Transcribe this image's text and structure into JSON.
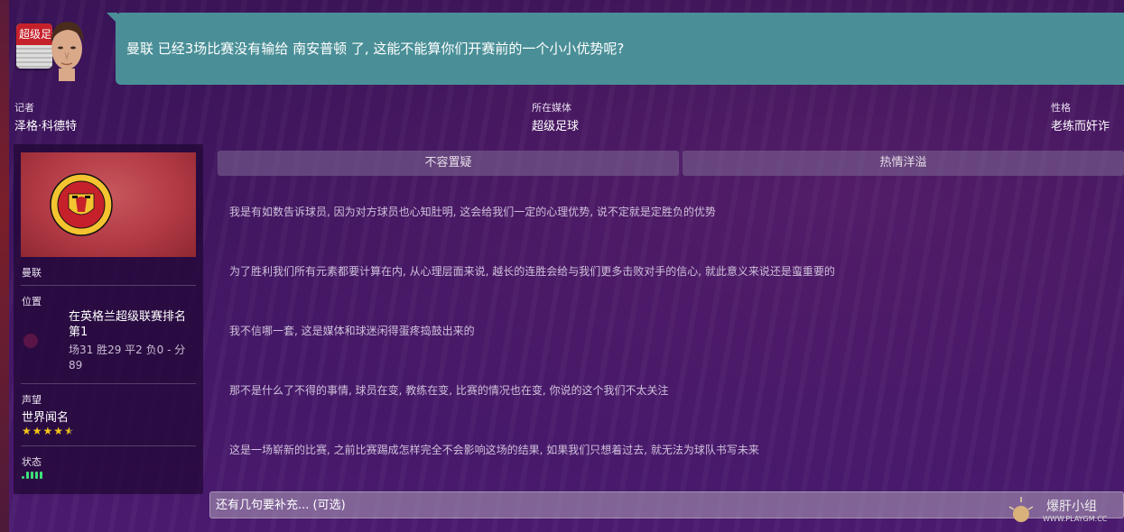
{
  "header": {
    "badge_label": "超级足球",
    "question": "曼联 已经3场比赛没有输给 南安普顿 了, 这能不能算你们开赛前的一个小小优势呢?"
  },
  "journalist": {
    "role_label": "记者",
    "name": "泽格·科德特",
    "media_label": "所在媒体",
    "media": "超级足球",
    "personality_label": "性格",
    "personality": "老练而奸诈"
  },
  "club": {
    "name": "曼联",
    "position_label": "位置",
    "position": "在英格兰超级联赛排名第1",
    "record": "场31 胜29 平2 负0 - 分 89",
    "reputation_label": "声望",
    "reputation": "世界闻名",
    "reputation_stars": 4.5,
    "status_label": "状态",
    "colors": {
      "primary": "#c6212b",
      "crest_gold": "#f4c430"
    }
  },
  "tones": [
    "不容置疑",
    "热情洋溢"
  ],
  "responses": [
    "我是有如数告诉球员, 因为对方球员也心知肚明, 这会给我们一定的心理优势, 说不定就是定胜负的优势",
    "为了胜利我们所有元素都要计算在内, 从心理层面来说, 越长的连胜会给与我们更多击败对手的信心, 就此意义来说还是蛮重要的",
    "我不信哪一套, 这是媒体和球迷闲得蛋疼捣鼓出来的",
    "那不是什么了不得的事情, 球员在变, 教练在变, 比赛的情况也在变, 你说的这个我们不太关注",
    "这是一场崭新的比赛, 之前比赛踢成怎样完全不会影响这场的结果, 如果我们只想着过去, 就无法为球队书写未来"
  ],
  "footer": {
    "placeholder": "还有几句要补充... (可选)"
  },
  "watermark": {
    "title": "爆肝小组",
    "url": "WWW.PLAYGM.CC"
  },
  "theme": {
    "speech_bubble": "#4a8f97",
    "background": "#3f1660",
    "status_green": "#3fe07a",
    "star_gold": "#f5c518"
  }
}
